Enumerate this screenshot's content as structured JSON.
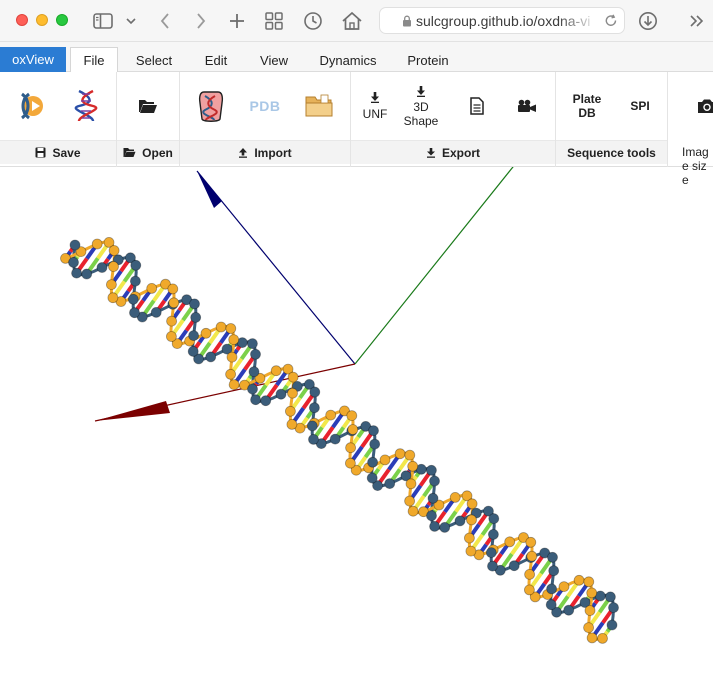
{
  "browser": {
    "address_text": "sulcgroup.github.io/oxdna-vi",
    "icons": [
      "sidebar-icon",
      "chevron-down-icon",
      "back-icon",
      "forward-icon",
      "new-tab-icon",
      "tab-overview-icon",
      "history-icon",
      "home-icon",
      "lock-icon",
      "reload-icon",
      "download-icon",
      "more-icon"
    ]
  },
  "app": {
    "name": "oxView"
  },
  "tabs": [
    {
      "label": "File",
      "active": true
    },
    {
      "label": "Select",
      "active": false
    },
    {
      "label": "Edit",
      "active": false
    },
    {
      "label": "View",
      "active": false
    },
    {
      "label": "Dynamics",
      "active": false
    },
    {
      "label": "Protein",
      "active": false
    }
  ],
  "ribbon": {
    "groups": {
      "save": "Save",
      "open": "Open",
      "import": "Import",
      "export": "Export",
      "sequence_tools": "Sequence tools",
      "image_size": "Image size"
    },
    "buttons": {
      "unf": "UNF",
      "shape_3d": "3D Shape",
      "plate_db": "Plate DB",
      "spi": "SPI",
      "pdb": "PDB"
    }
  },
  "scene": {
    "axis_colors": {
      "x": "#7b0000",
      "y": "#1a7a1a",
      "z": "#00006e"
    },
    "strand_colors": {
      "backbone_a": "#3b5d7a",
      "backbone_b": "#f0a92b"
    },
    "base_colors": [
      "#e8222e",
      "#2b3db8",
      "#7bd14a",
      "#f2e84b"
    ]
  }
}
